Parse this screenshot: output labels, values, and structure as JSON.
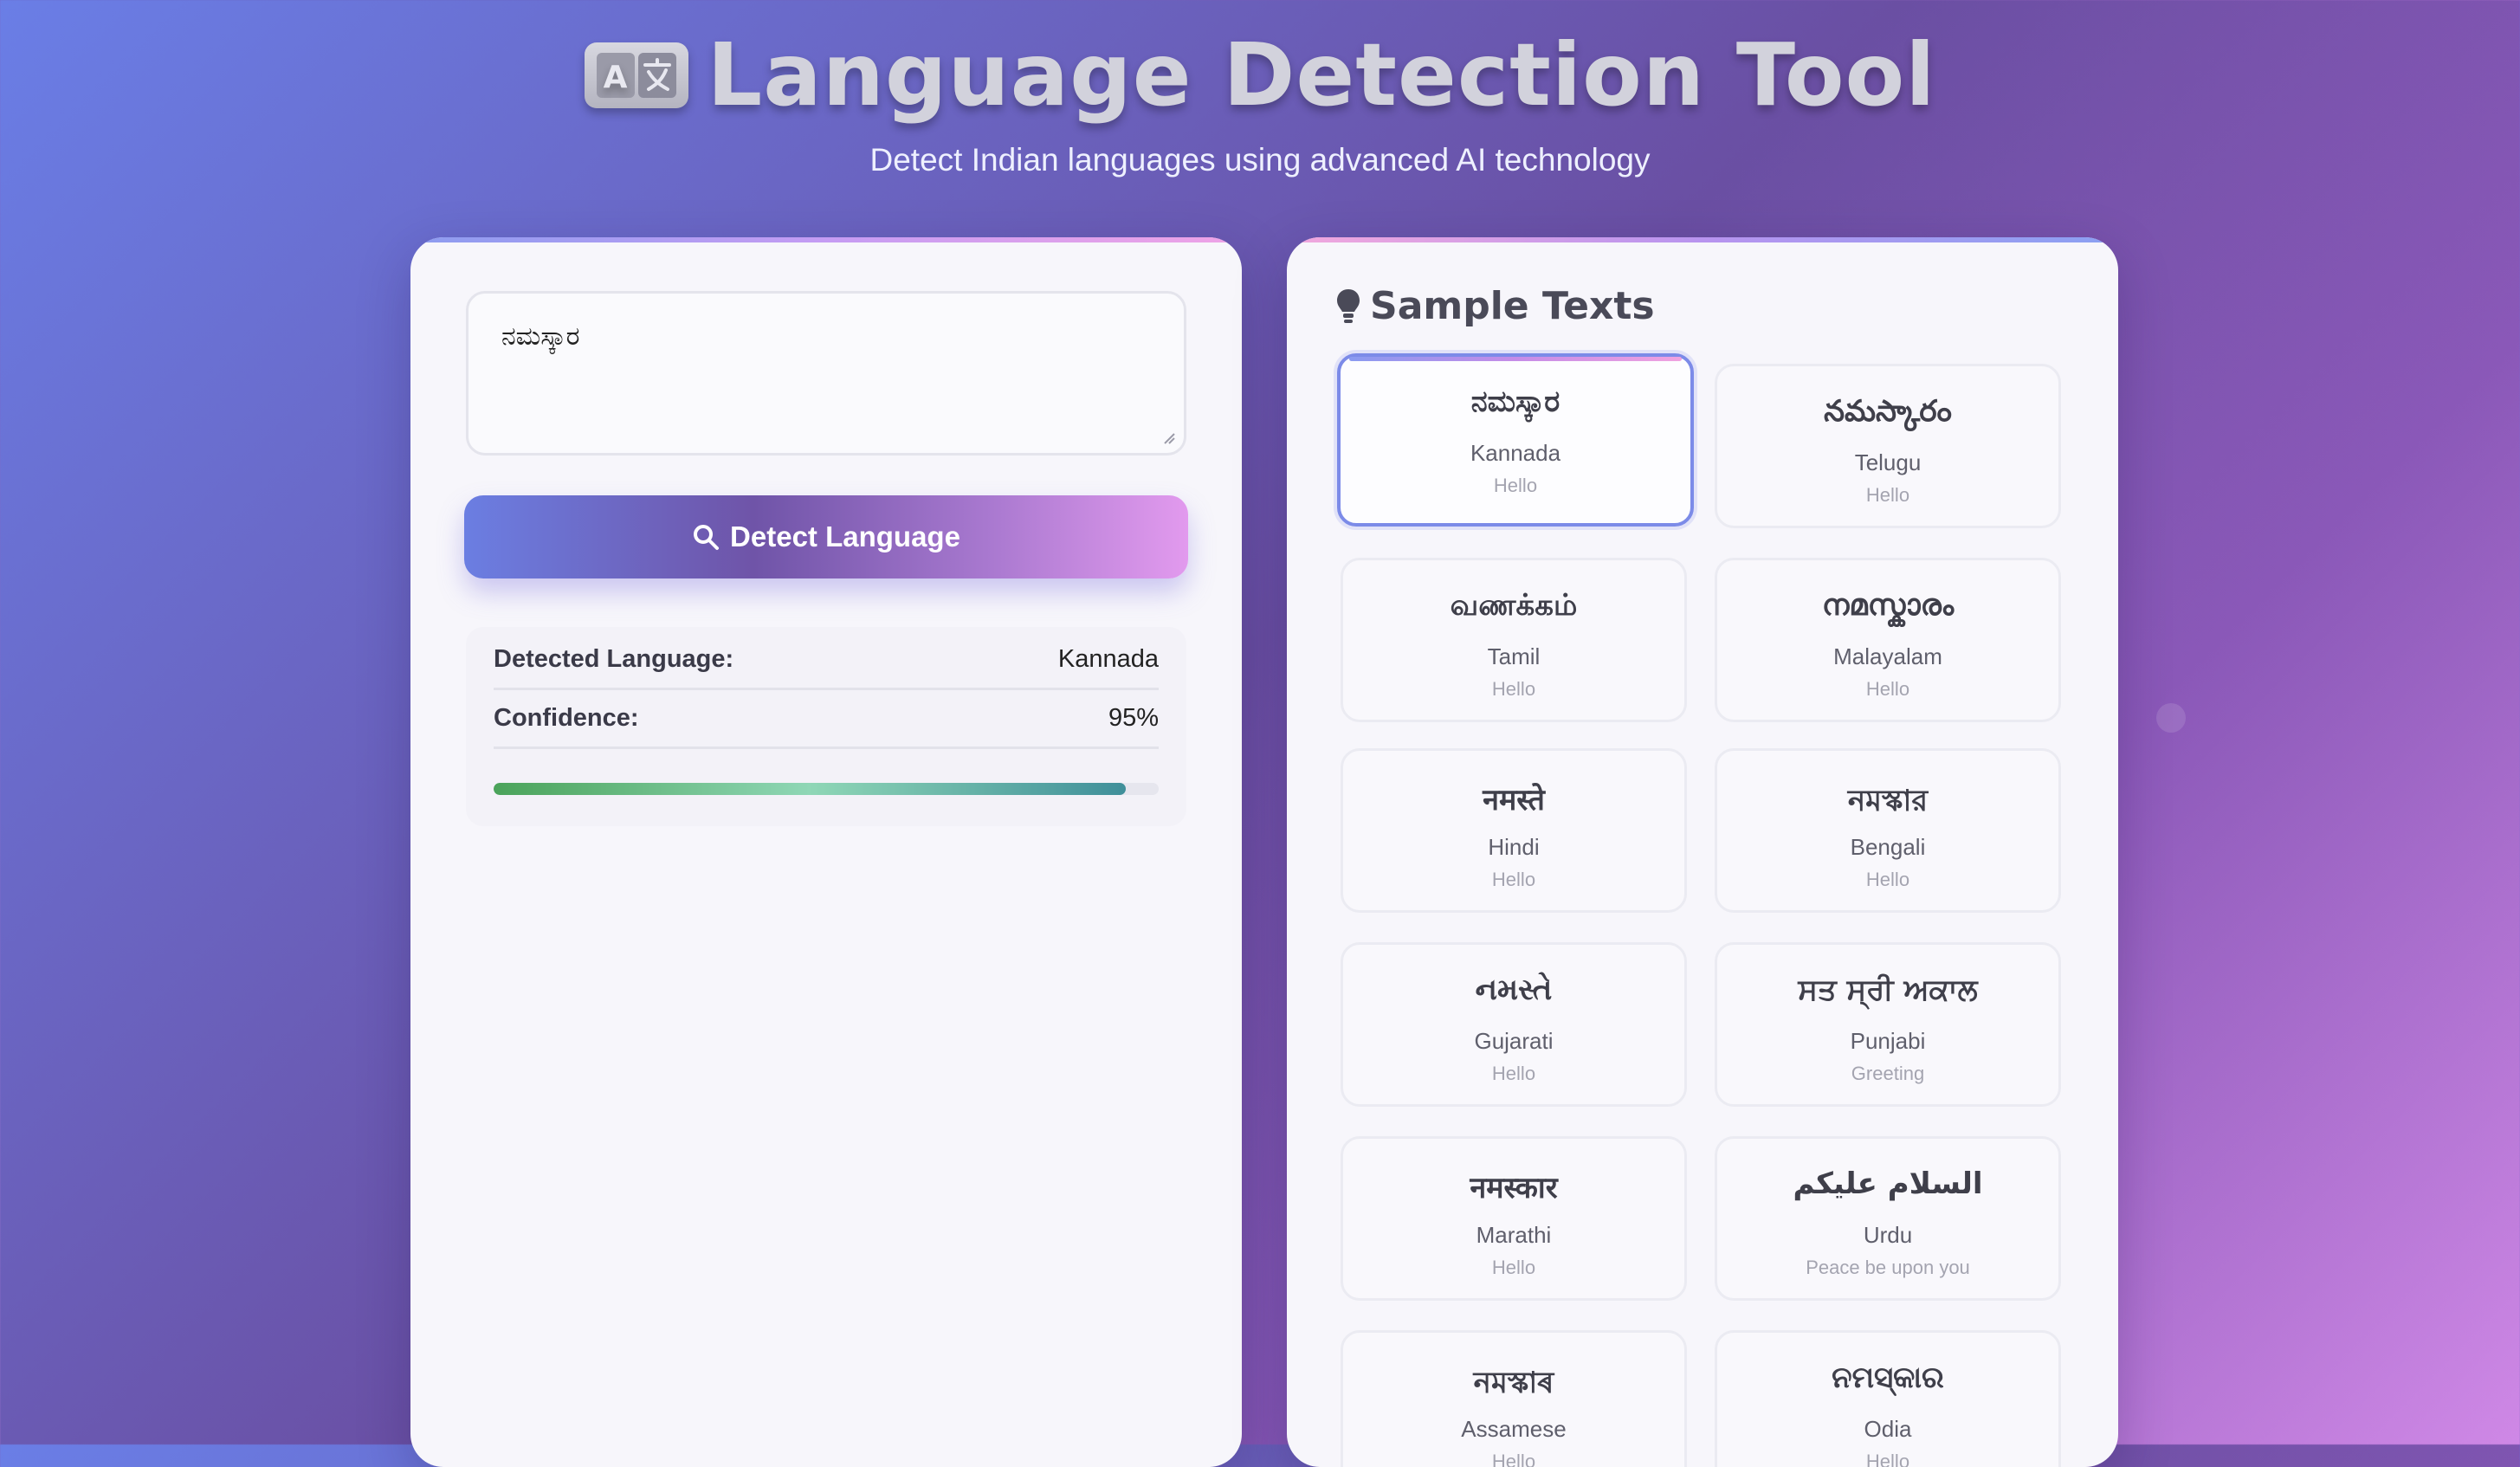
{
  "header": {
    "title": "Language Detection Tool",
    "subtitle": "Detect Indian languages using advanced AI technology",
    "icon": "translate-icon"
  },
  "input": {
    "value": "ನಮಸ್ಕಾರ"
  },
  "detect_button": {
    "label": "Detect Language",
    "icon": "search-icon"
  },
  "result": {
    "language_label": "Detected Language:",
    "language_value": "Kannada",
    "confidence_label": "Confidence:",
    "confidence_value": "95%",
    "confidence_fraction": 0.95
  },
  "samples": {
    "title": "Sample Texts",
    "icon": "lightbulb-icon",
    "items": [
      {
        "text": "ನಮಸ್ಕಾರ",
        "language": "Kannada",
        "meaning": "Hello",
        "selected": true
      },
      {
        "text": "నమస్కారం",
        "language": "Telugu",
        "meaning": "Hello",
        "selected": false
      },
      {
        "text": "வணக்கம்",
        "language": "Tamil",
        "meaning": "Hello",
        "selected": false
      },
      {
        "text": "നമസ്കാരം",
        "language": "Malayalam",
        "meaning": "Hello",
        "selected": false
      },
      {
        "text": "नमस्ते",
        "language": "Hindi",
        "meaning": "Hello",
        "selected": false
      },
      {
        "text": "নমস্কার",
        "language": "Bengali",
        "meaning": "Hello",
        "selected": false
      },
      {
        "text": "નમસ્તે",
        "language": "Gujarati",
        "meaning": "Hello",
        "selected": false
      },
      {
        "text": "ਸਤ ਸ੍ਰੀ ਅਕਾਲ",
        "language": "Punjabi",
        "meaning": "Greeting",
        "selected": false
      },
      {
        "text": "नमस्कार",
        "language": "Marathi",
        "meaning": "Hello",
        "selected": false
      },
      {
        "text": "السلام علیکم",
        "language": "Urdu",
        "meaning": "Peace be upon you",
        "selected": false
      },
      {
        "text": "নমস্কাৰ",
        "language": "Assamese",
        "meaning": "Hello",
        "selected": false
      },
      {
        "text": "ନମସ୍କାର",
        "language": "Odia",
        "meaning": "Hello",
        "selected": false
      }
    ]
  }
}
